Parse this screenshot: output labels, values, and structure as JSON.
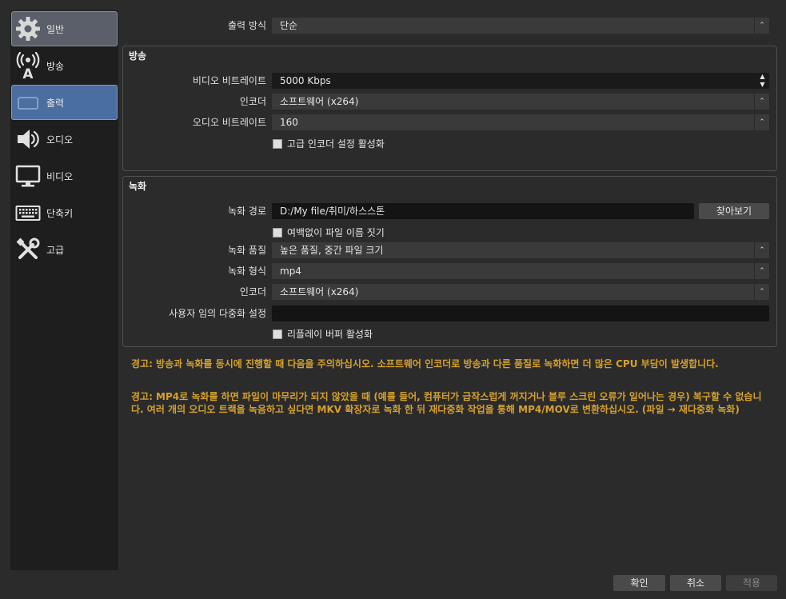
{
  "sidebar": {
    "items": [
      {
        "label": "일반",
        "icon": "gear-icon"
      },
      {
        "label": "방송",
        "icon": "broadcast-icon"
      },
      {
        "label": "출력",
        "icon": "output-icon"
      },
      {
        "label": "오디오",
        "icon": "speaker-icon"
      },
      {
        "label": "비디오",
        "icon": "monitor-icon"
      },
      {
        "label": "단축키",
        "icon": "keyboard-icon"
      },
      {
        "label": "고급",
        "icon": "tools-icon"
      }
    ]
  },
  "output_mode": {
    "label": "출력 방식",
    "value": "단순"
  },
  "streaming": {
    "title": "방송",
    "video_bitrate": {
      "label": "비디오 비트레이트",
      "value": "5000 Kbps"
    },
    "encoder": {
      "label": "인코더",
      "value": "소프트웨어 (x264)"
    },
    "audio_bitrate": {
      "label": "오디오 비트레이트",
      "value": "160"
    },
    "advanced_encoder": {
      "label": "고급 인코더 설정 활성화"
    }
  },
  "recording": {
    "title": "녹화",
    "path": {
      "label": "녹화 경로",
      "value": "D:/My file/취미/하스스톤"
    },
    "browse_label": "찾아보기",
    "no_space_filename": {
      "label": "여백없이 파일 이름 짓기"
    },
    "quality": {
      "label": "녹화 품질",
      "value": "높은 품질, 중간 파일 크기"
    },
    "format": {
      "label": "녹화 형식",
      "value": "mp4"
    },
    "encoder": {
      "label": "인코더",
      "value": "소프트웨어 (x264)"
    },
    "custom_muxer": {
      "label": "사용자 임의 다중화 설정",
      "value": ""
    },
    "replay_buffer": {
      "label": "리플레이 버퍼 활성화"
    }
  },
  "warnings": {
    "warning1": "경고: 방송과 녹화를 동시에 진행할 때 다음을 주의하십시오. 소프트웨어 인코더로 방송과 다른 품질로 녹화하면 더 많은 CPU 부담이 발생합니다.",
    "warning2": "경고: MP4로 녹화를 하면 파일이 마무리가 되지 않았을 때 (예를 들어, 컴퓨터가 급작스럽게 꺼지거나 블루 스크린 오류가 일어나는 경우) 복구할 수 없습니다. 여러 개의 오디오 트랙을 녹음하고 싶다면 MKV 확장자로 녹화 한 뒤 재다중화 작업을 통해 MP4/MOV로 변환하십시오. (파일 → 재다중화 녹화)"
  },
  "footer": {
    "ok_label": "확인",
    "cancel_label": "취소",
    "apply_label": "적용"
  },
  "colors": {
    "warning": "#d6a12c",
    "selected": "#4b6ea0",
    "background": "#2b2b2b"
  }
}
